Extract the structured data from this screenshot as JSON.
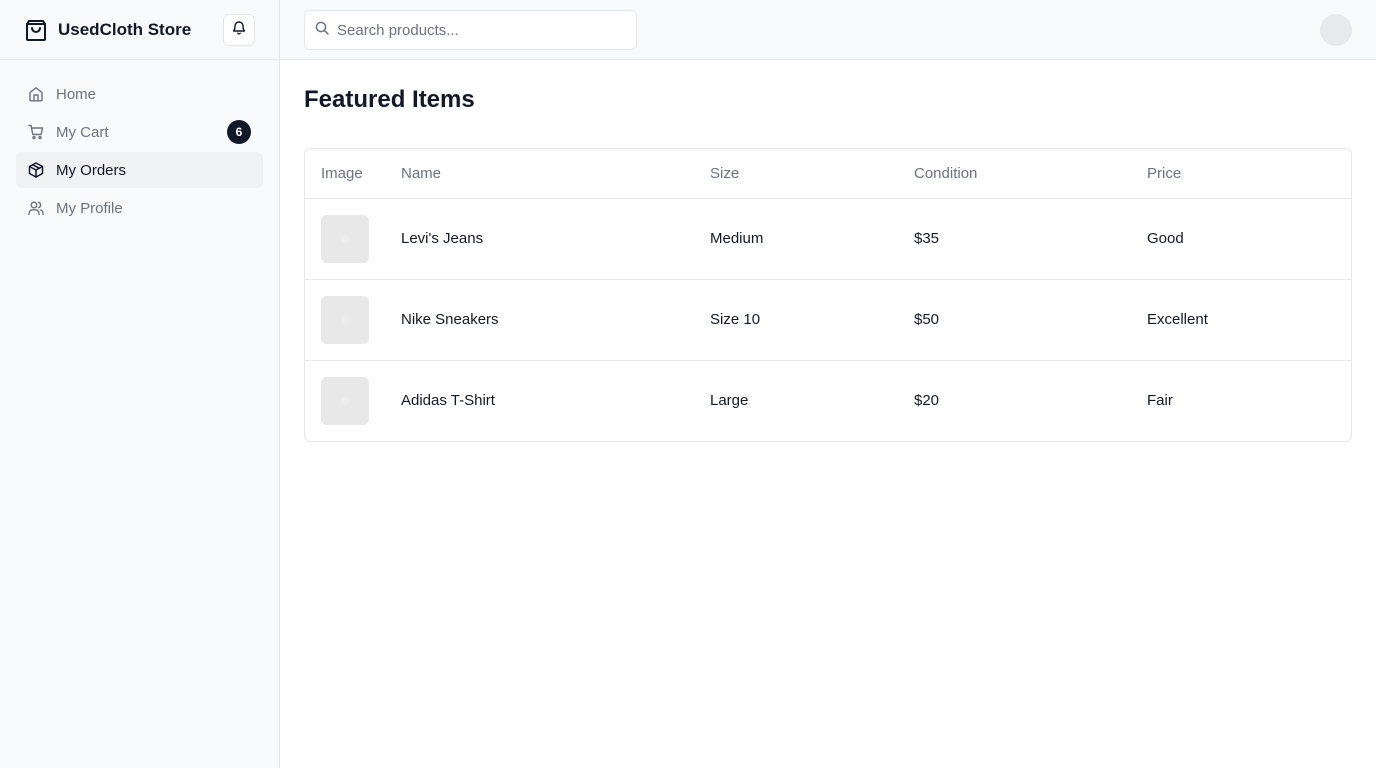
{
  "brand": {
    "name": "UsedCloth Store",
    "icon": "shopping-bag-icon"
  },
  "sidebar": {
    "items": [
      {
        "label": "Home",
        "icon": "home-icon",
        "active": false
      },
      {
        "label": "My Cart",
        "icon": "cart-icon",
        "badge": "6",
        "active": false
      },
      {
        "label": "My Orders",
        "icon": "package-icon",
        "active": true
      },
      {
        "label": "My Profile",
        "icon": "users-icon",
        "active": false
      }
    ]
  },
  "search": {
    "placeholder": "Search products...",
    "value": ""
  },
  "main": {
    "title": "Featured Items",
    "columns": [
      "Image",
      "Name",
      "Size",
      "Condition",
      "Price"
    ],
    "rows": [
      {
        "name": "Levi's Jeans",
        "size": "Medium",
        "condition": "$35",
        "price": "Good"
      },
      {
        "name": "Nike Sneakers",
        "size": "Size 10",
        "condition": "$50",
        "price": "Excellent"
      },
      {
        "name": "Adidas T-Shirt",
        "size": "Large",
        "condition": "$20",
        "price": "Fair"
      }
    ]
  },
  "colors": {
    "accent": "#111827",
    "muted": "#6b7280",
    "border": "#e5e7eb",
    "sidebar_bg": "#f9fafb"
  }
}
